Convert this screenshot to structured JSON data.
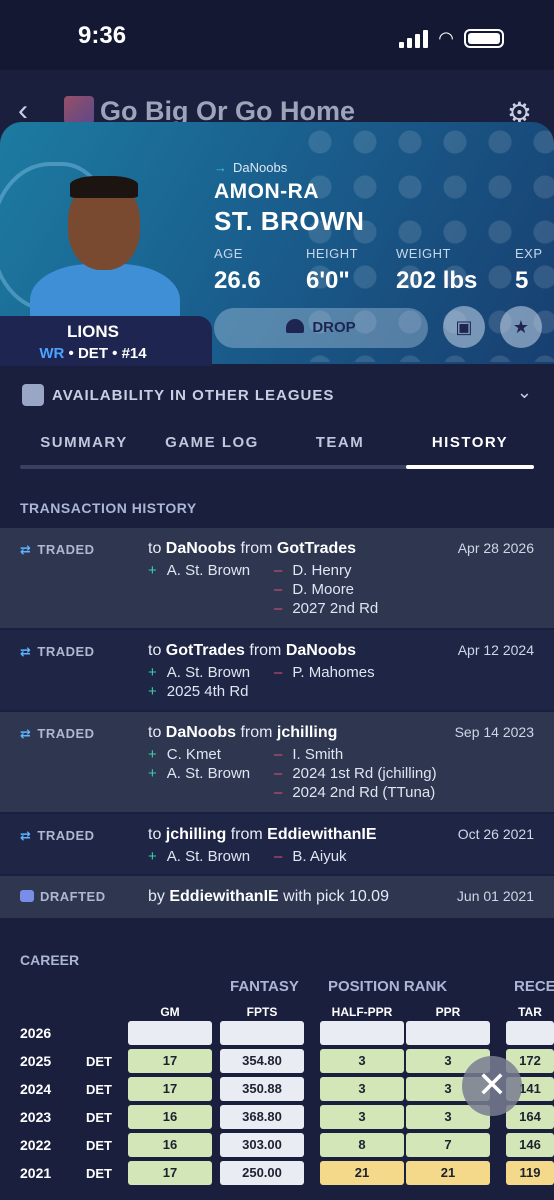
{
  "status_bar": {
    "time": "9:36"
  },
  "nav": {
    "title": "Go Big Or Go Home"
  },
  "player": {
    "owner": "DaNoobs",
    "first_name": "AMON-RA",
    "last_name": "ST. BROWN",
    "team": "LIONS",
    "position": "WR",
    "meta_rest": " • DET • #14",
    "stats": [
      {
        "label": "AGE",
        "value": "26.6"
      },
      {
        "label": "HEIGHT",
        "value": "6'0\""
      },
      {
        "label": "WEIGHT",
        "value": "202 lbs"
      },
      {
        "label": "EXP",
        "value": "5"
      }
    ],
    "drop_label": "DROP"
  },
  "availability": {
    "label": "AVAILABILITY IN OTHER LEAGUES"
  },
  "tabs": [
    "SUMMARY",
    "GAME LOG",
    "TEAM",
    "HISTORY"
  ],
  "active_tab": "HISTORY",
  "transaction_history": {
    "title": "TRANSACTION HISTORY",
    "rows": [
      {
        "type": "TRADED",
        "to": "DaNoobs",
        "from": "GotTrades",
        "date": "Apr 28 2026",
        "adds": [
          "A. St. Brown"
        ],
        "drops": [
          "D. Henry",
          "D. Moore",
          "2027 2nd Rd"
        ]
      },
      {
        "type": "TRADED",
        "to": "GotTrades",
        "from": "DaNoobs",
        "date": "Apr 12 2024",
        "adds": [
          "A. St. Brown",
          "2025 4th Rd"
        ],
        "drops": [
          "P. Mahomes"
        ]
      },
      {
        "type": "TRADED",
        "to": "DaNoobs",
        "from": "jchilling",
        "date": "Sep 14 2023",
        "adds": [
          "C. Kmet",
          "A. St. Brown"
        ],
        "drops": [
          "I. Smith",
          "2024 1st Rd (jchilling)",
          "2024 2nd Rd (TTuna)"
        ]
      },
      {
        "type": "TRADED",
        "to": "jchilling",
        "from": "EddiewithanIE",
        "date": "Oct 26 2021",
        "adds": [
          "A. St. Brown"
        ],
        "drops": [
          "B. Aiyuk"
        ]
      }
    ],
    "draft": {
      "type": "DRAFTED",
      "by": "EddiewithanIE",
      "pick": "10.09",
      "date": "Jun 01 2021"
    }
  },
  "career": {
    "title": "CAREER",
    "groups": [
      "FANTASY",
      "POSITION RANK",
      "RECE"
    ],
    "columns": [
      "GM",
      "FPTS",
      "HALF-PPR",
      "PPR",
      "TAR"
    ],
    "rows": [
      {
        "year": "2026",
        "team": "",
        "gm": "",
        "fpts": "",
        "half": "",
        "ppr": "",
        "tar": ""
      },
      {
        "year": "2025",
        "team": "DET",
        "gm": "17",
        "fpts": "354.80",
        "half": "3",
        "ppr": "3",
        "tar": "172"
      },
      {
        "year": "2024",
        "team": "DET",
        "gm": "17",
        "fpts": "350.88",
        "half": "3",
        "ppr": "3",
        "tar": "141"
      },
      {
        "year": "2023",
        "team": "DET",
        "gm": "16",
        "fpts": "368.80",
        "half": "3",
        "ppr": "3",
        "tar": "164"
      },
      {
        "year": "2022",
        "team": "DET",
        "gm": "16",
        "fpts": "303.00",
        "half": "8",
        "ppr": "7",
        "tar": "146"
      },
      {
        "year": "2021",
        "team": "DET",
        "gm": "17",
        "fpts": "250.00",
        "half": "21",
        "ppr": "21",
        "tar": "119"
      }
    ]
  },
  "colors": {
    "accent": "#4aa3ff",
    "add": "#3ccfa8",
    "drop": "#e2506e",
    "rank_top": "#d3e6b8",
    "rank_mid": "#f5d98a"
  }
}
